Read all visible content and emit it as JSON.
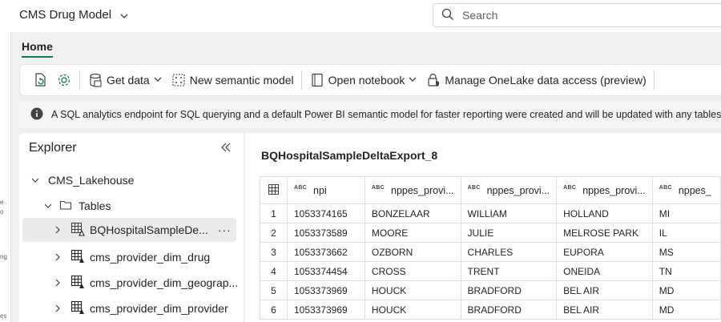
{
  "app": {
    "title": "CMS Drug Model"
  },
  "search": {
    "placeholder": "Search"
  },
  "left_strip": {
    "fragments": [
      "e",
      "o",
      "ng",
      "es"
    ]
  },
  "tabs": {
    "home": "Home"
  },
  "toolbar": {
    "get_data": "Get data",
    "new_semantic_model": "New semantic model",
    "open_notebook": "Open notebook",
    "manage_onelake": "Manage OneLake data access (preview)"
  },
  "banner": {
    "text": "A SQL analytics endpoint for SQL querying and a default Power BI semantic model for faster reporting were created and will be updated with any tables added"
  },
  "explorer": {
    "title": "Explorer",
    "lakehouse": "CMS_Lakehouse",
    "tables_folder": "Tables",
    "tables": [
      {
        "label": "BQHospitalSampleDe...",
        "more": "···"
      },
      {
        "label": "cms_provider_dim_drug"
      },
      {
        "label": "cms_provider_dim_geograp..."
      },
      {
        "label": "cms_provider_dim_provider"
      }
    ]
  },
  "preview": {
    "title": "BQHospitalSampleDeltaExport_8",
    "type_tag": "ABC",
    "columns": [
      "npi",
      "nppes_provi...",
      "nppes_provi...",
      "nppes_provi...",
      "nppes_"
    ],
    "rows": [
      [
        "1",
        "1053374165",
        "BONZELAAR",
        "WILLIAM",
        "HOLLAND",
        "MI"
      ],
      [
        "2",
        "1053373589",
        "MOORE",
        "JULIE",
        "MELROSE PARK",
        "IL"
      ],
      [
        "3",
        "1053373662",
        "OZBORN",
        "CHARLES",
        "EUPORA",
        "MS"
      ],
      [
        "4",
        "1053374454",
        "CROSS",
        "TRENT",
        "ONEIDA",
        "TN"
      ],
      [
        "5",
        "1053373969",
        "HOUCK",
        "BRADFORD",
        "BEL AIR",
        "MD"
      ],
      [
        "6",
        "1053373969",
        "HOUCK",
        "BRADFORD",
        "BEL AIR",
        "MD"
      ]
    ]
  },
  "colors": {
    "accent": "#117865",
    "panel_bg": "#f0f0f0"
  }
}
